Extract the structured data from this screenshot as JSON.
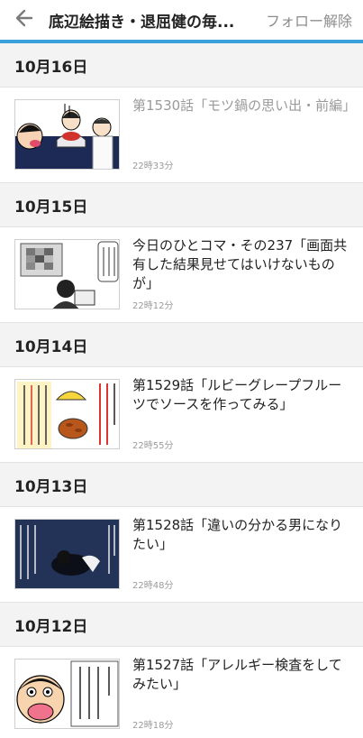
{
  "header": {
    "back_icon": "arrow-left-icon",
    "title": "底辺絵描き・退屈健の毎...",
    "unfollow_label": "フォロー解除"
  },
  "colors": {
    "accent": "#39a0dc",
    "read_title": "#9a9a9a"
  },
  "feed": [
    {
      "date": "10月16日",
      "title": "第1530話「モツ鍋の思い出・前編」",
      "time": "22時33分",
      "read": true
    },
    {
      "date": "10月15日",
      "title": "今日のひとコマ・その237「画面共有した結果見せてはいけないものが」",
      "time": "22時12分",
      "read": false
    },
    {
      "date": "10月14日",
      "title": "第1529話「ルビーグレープフルーツでソースを作ってみる」",
      "time": "22時55分",
      "read": false
    },
    {
      "date": "10月13日",
      "title": "第1528話「違いの分かる男になりたい」",
      "time": "22時48分",
      "read": false
    },
    {
      "date": "10月12日",
      "title": "第1527話「アレルギー検査をしてみたい」",
      "time": "22時18分",
      "read": false
    }
  ]
}
